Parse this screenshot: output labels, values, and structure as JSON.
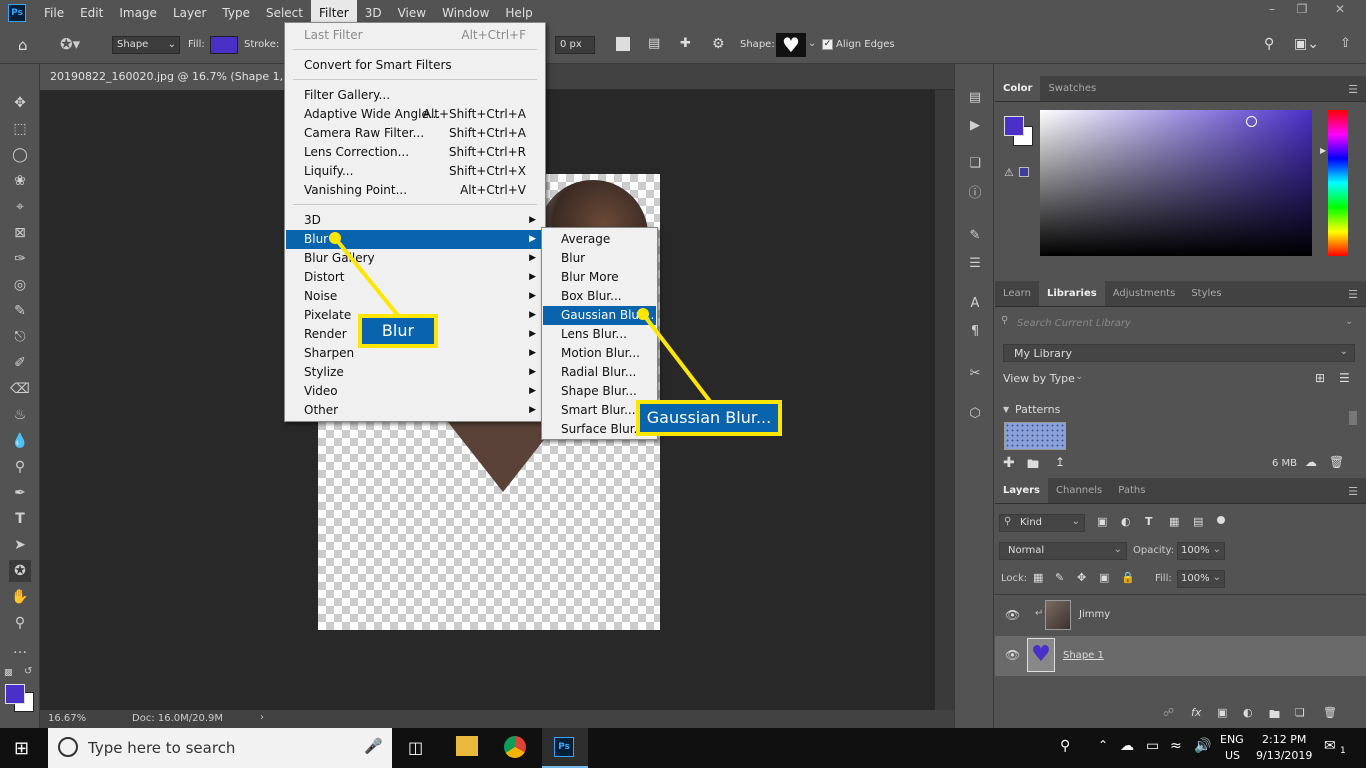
{
  "menubar": {
    "items": [
      "File",
      "Edit",
      "Image",
      "Layer",
      "Type",
      "Select",
      "Filter",
      "3D",
      "View",
      "Window",
      "Help"
    ],
    "active": "Filter"
  },
  "options": {
    "mode": "Shape",
    "fill_label": "Fill:",
    "stroke_label": "Stroke:",
    "stroke_width": "0 px",
    "shape_label": "Shape:",
    "align_edges": "Align Edges",
    "fill_color": "#4a2fc9"
  },
  "document": {
    "tab_title": "20190822_160020.jpg @ 16.7% (Shape 1, RGB",
    "zoom": "16.67%",
    "doc_size": "Doc: 16.0M/20.9M"
  },
  "filter_menu": {
    "items": [
      {
        "label": "Last Filter",
        "shortcut": "Alt+Ctrl+F",
        "disabled": true
      },
      {
        "label": "Convert for Smart Filters",
        "shortcut": ""
      },
      {
        "label": "Filter Gallery...",
        "shortcut": ""
      },
      {
        "label": "Adaptive Wide Angle...",
        "shortcut": "Alt+Shift+Ctrl+A"
      },
      {
        "label": "Camera Raw Filter...",
        "shortcut": "Shift+Ctrl+A"
      },
      {
        "label": "Lens Correction...",
        "shortcut": "Shift+Ctrl+R"
      },
      {
        "label": "Liquify...",
        "shortcut": "Shift+Ctrl+X"
      },
      {
        "label": "Vanishing Point...",
        "shortcut": "Alt+Ctrl+V"
      },
      {
        "label": "3D",
        "shortcut": ""
      },
      {
        "label": "Blur",
        "shortcut": ""
      },
      {
        "label": "Blur Gallery",
        "shortcut": ""
      },
      {
        "label": "Distort",
        "shortcut": ""
      },
      {
        "label": "Noise",
        "shortcut": ""
      },
      {
        "label": "Pixelate",
        "shortcut": ""
      },
      {
        "label": "Render",
        "shortcut": ""
      },
      {
        "label": "Sharpen",
        "shortcut": ""
      },
      {
        "label": "Stylize",
        "shortcut": ""
      },
      {
        "label": "Video",
        "shortcut": ""
      },
      {
        "label": "Other",
        "shortcut": ""
      }
    ]
  },
  "blur_submenu": {
    "items": [
      "Average",
      "Blur",
      "Blur More",
      "Box Blur...",
      "Gaussian Blur...",
      "Lens Blur...",
      "Motion Blur...",
      "Radial Blur...",
      "Shape Blur...",
      "Smart Blur...",
      "Surface Blur..."
    ],
    "highlighted": "Gaussian Blur..."
  },
  "callouts": {
    "blur": "Blur",
    "gaussian": "Gaussian Blur..."
  },
  "color_panel": {
    "tabs": [
      "Color",
      "Swatches"
    ],
    "fg_color": "#4a2fc9",
    "bg_color": "#ffffff"
  },
  "libraries_panel": {
    "tabs": [
      "Learn",
      "Libraries",
      "Adjustments",
      "Styles"
    ],
    "search_placeholder": "Search Current Library",
    "library": "My Library",
    "view_by": "View by Type",
    "section": "Patterns",
    "size": "6 MB"
  },
  "layers_panel": {
    "tabs": [
      "Layers",
      "Channels",
      "Paths"
    ],
    "filter_kind": "Kind",
    "blend_mode": "Normal",
    "opacity_label": "Opacity:",
    "opacity": "100%",
    "lock_label": "Lock:",
    "fill_label": "Fill:",
    "fill": "100%",
    "layers": [
      {
        "name": "Jimmy"
      },
      {
        "name": "Shape 1"
      }
    ]
  },
  "taskbar": {
    "search_placeholder": "Type here to search",
    "lang": "ENG",
    "region": "US",
    "time": "2:12 PM",
    "date": "9/13/2019",
    "notifications": "1"
  }
}
